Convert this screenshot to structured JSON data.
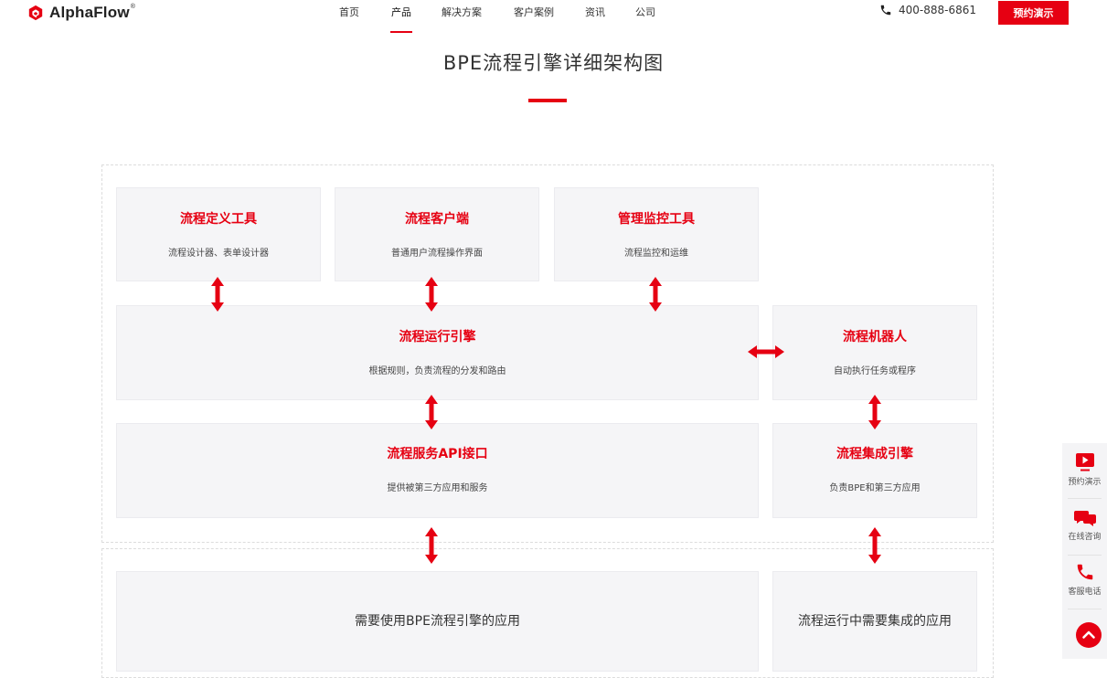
{
  "header": {
    "brand": "AlphaFlow",
    "brand_mark": "®",
    "nav": [
      {
        "label": "首页"
      },
      {
        "label": "产品"
      },
      {
        "label": "解决方案"
      },
      {
        "label": "客户案例"
      },
      {
        "label": "资讯"
      },
      {
        "label": "公司"
      }
    ],
    "active_nav": "产品",
    "phone": "400-888-6861",
    "demo_button": "预约演示"
  },
  "page": {
    "title": "BPE流程引擎详细架构图"
  },
  "diagram": {
    "tools": [
      {
        "title": "流程定义工具",
        "desc": "流程设计器、表单设计器"
      },
      {
        "title": "流程客户端",
        "desc": "普通用户流程操作界面"
      },
      {
        "title": "管理监控工具",
        "desc": "流程监控和运维"
      }
    ],
    "engine": {
      "title": "流程运行引擎",
      "desc": "根据规则，负责流程的分发和路由"
    },
    "robot": {
      "title": "流程机器人",
      "desc": "自动执行任务或程序"
    },
    "api": {
      "title": "流程服务API接口",
      "desc": "提供被第三方应用和服务"
    },
    "integration": {
      "title": "流程集成引擎",
      "desc": "负责BPE和第三方应用"
    },
    "apps_left": "需要使用BPE流程引擎的应用",
    "apps_right": "流程运行中需要集成的应用"
  },
  "float_bar": {
    "items": [
      {
        "label": "预约演示",
        "icon": "video-play-icon"
      },
      {
        "label": "在线咨询",
        "icon": "chat-bubbles-icon"
      },
      {
        "label": "客服电话",
        "icon": "phone-icon"
      }
    ],
    "top_icon": "chevron-up-icon"
  },
  "colors": {
    "accent": "#e60012",
    "box_bg": "#f5f5f7",
    "text": "#333333"
  }
}
